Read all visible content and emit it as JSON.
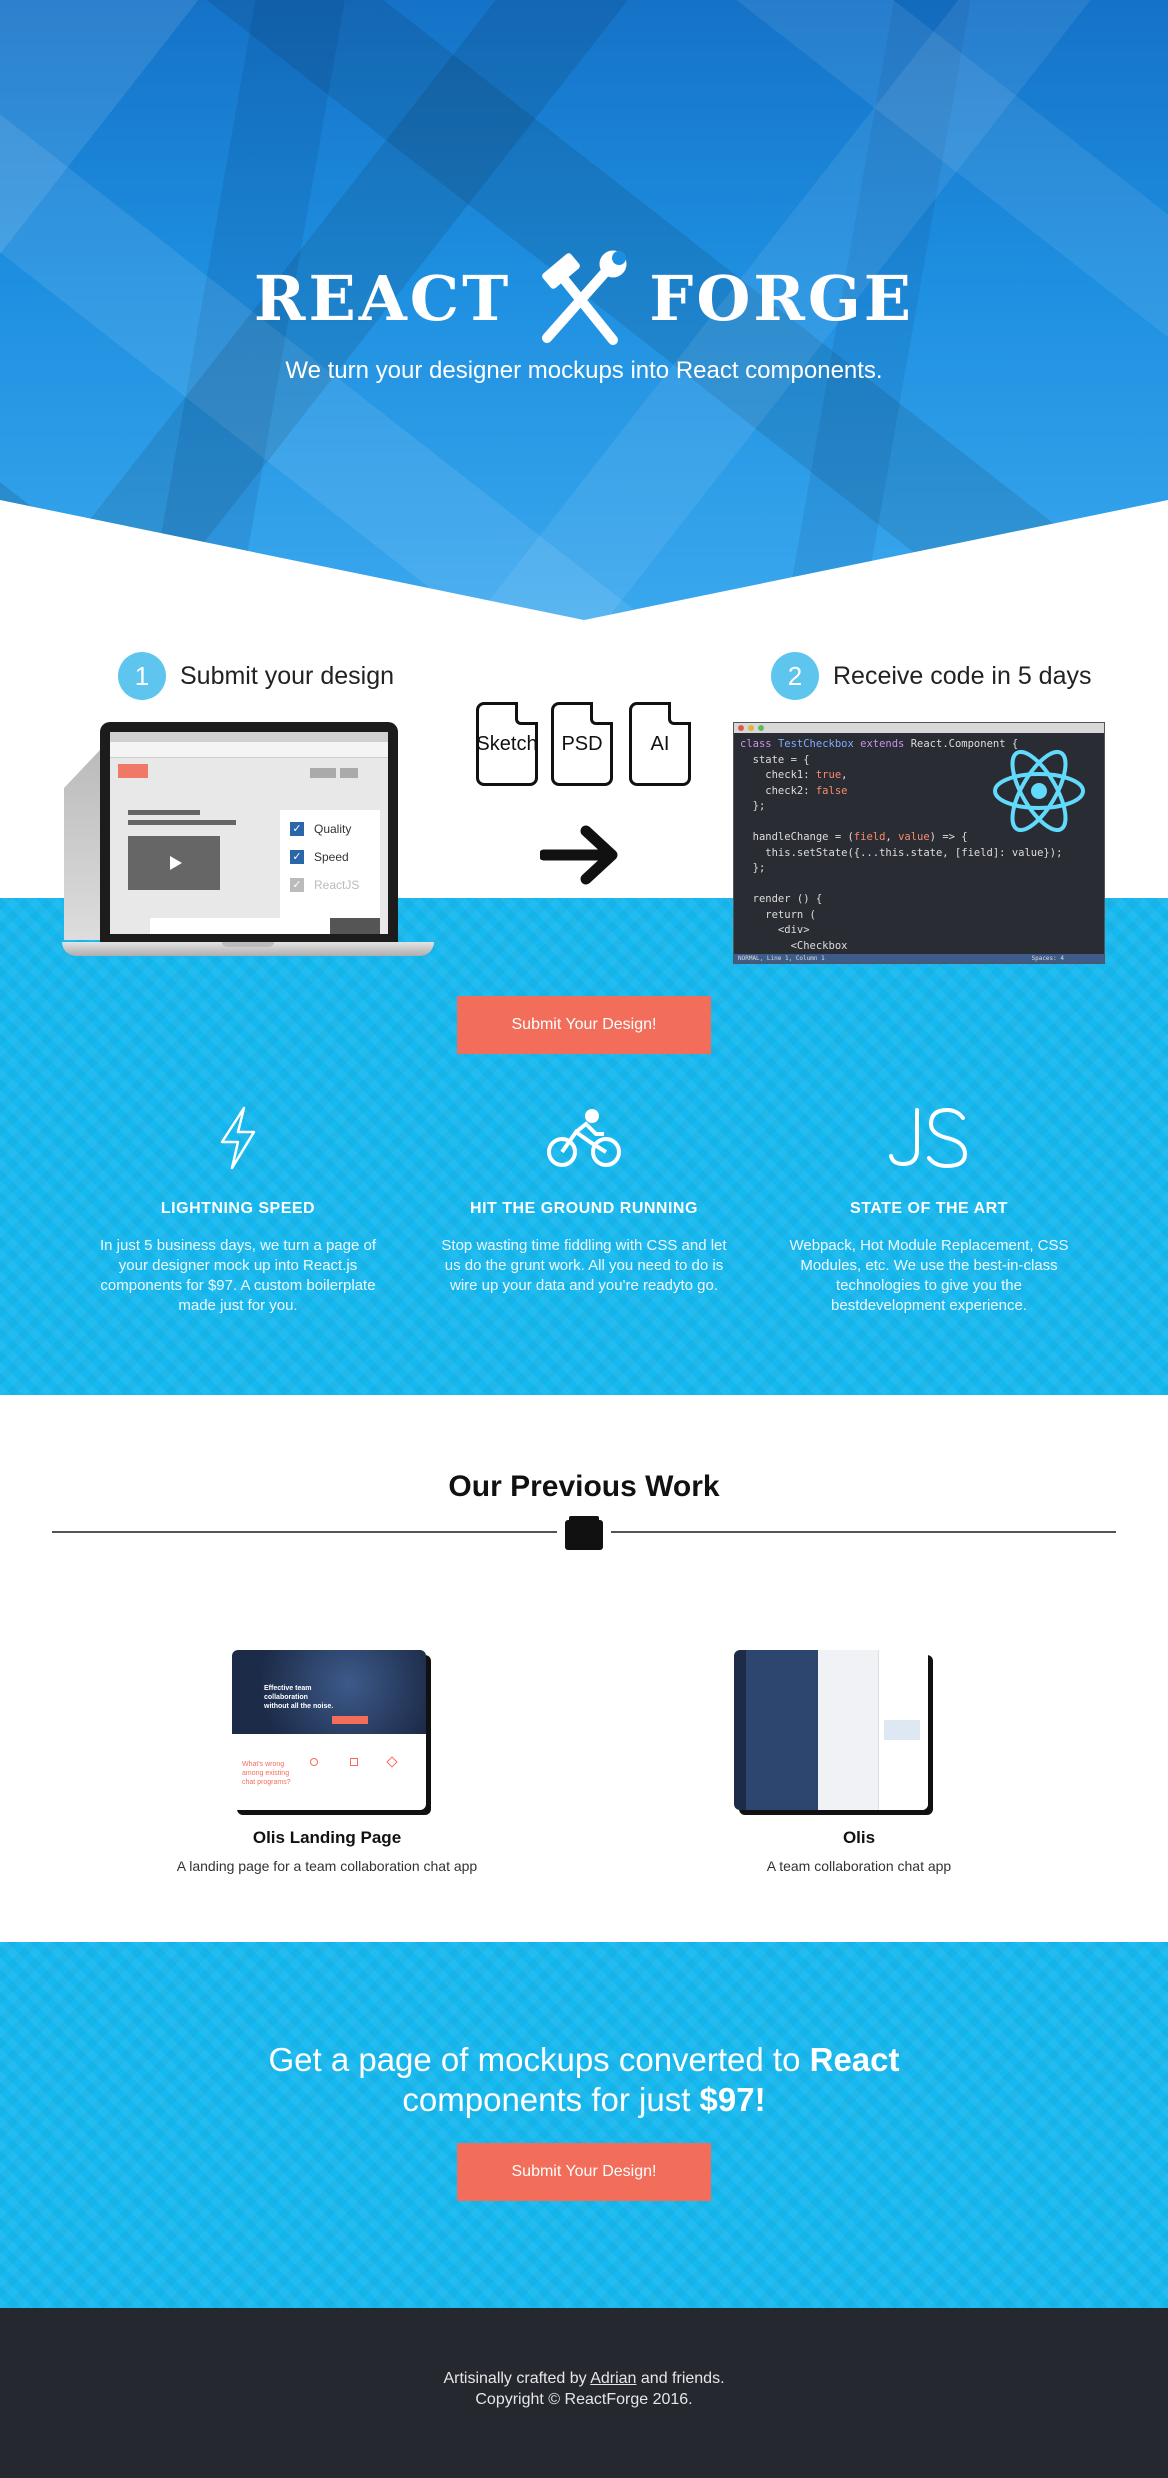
{
  "hero": {
    "logo_left": "REACT",
    "logo_right": "FORGE",
    "tagline": "We turn your designer mockups into React components."
  },
  "steps": [
    {
      "number": "1",
      "label": "Submit your design"
    },
    {
      "number": "2",
      "label": "Receive code in 5 days"
    }
  ],
  "mockup": {
    "checkboxes": [
      "Quality",
      "Speed",
      "ReactJS"
    ]
  },
  "file_types": [
    "Sketch",
    "PSD",
    "AI"
  ],
  "editor": {
    "status_left": "NORMAL, Line 1, Column 1",
    "status_right": "Spaces: 4"
  },
  "cta_label": "Submit Your Design!",
  "features": [
    {
      "icon": "lightning-icon",
      "title": "LIGHTNING SPEED",
      "text": "In just 5 business days, we turn a page of your designer mock up into React.js components for $97. A custom boilerplate made just for you."
    },
    {
      "icon": "bicycle-icon",
      "title": "HIT THE GROUND RUNNING",
      "text": "Stop wasting time fiddling with CSS and let us do the grunt work. All you need to do is wire up your data and you're readyto go."
    },
    {
      "icon": "js-icon",
      "title": "STATE OF THE ART",
      "text": "Webpack, Hot Module Replacement, CSS Modules, etc. We use the best-in-class technologies to give you the bestdevelopment experience."
    }
  ],
  "previous_work": {
    "title": "Our Previous Work",
    "items": [
      {
        "title": "Olis Landing Page",
        "description": "A landing page for a team collaboration chat app",
        "thumb_heading": "Effective team collaboration without all the noise.",
        "thumb_sub": "What's wrong among existing chat programs?"
      },
      {
        "title": "Olis",
        "description": "A team collaboration chat app"
      }
    ]
  },
  "pitch": {
    "line1_a": "Get a page of mockups converted to ",
    "line1_b": "React",
    "line2_a": "components for just ",
    "line2_b": "$97!"
  },
  "footer": {
    "line1_a": "Artisinally crafted by ",
    "line1_link": "Adrian",
    "line1_b": " and friends.",
    "line2": "Copyright © ReactForge 2016."
  },
  "colors": {
    "hero_blue": "#1e8fe0",
    "band_blue": "#16b9ef",
    "cta_coral": "#f36e5a",
    "footer_dark": "#262830"
  }
}
